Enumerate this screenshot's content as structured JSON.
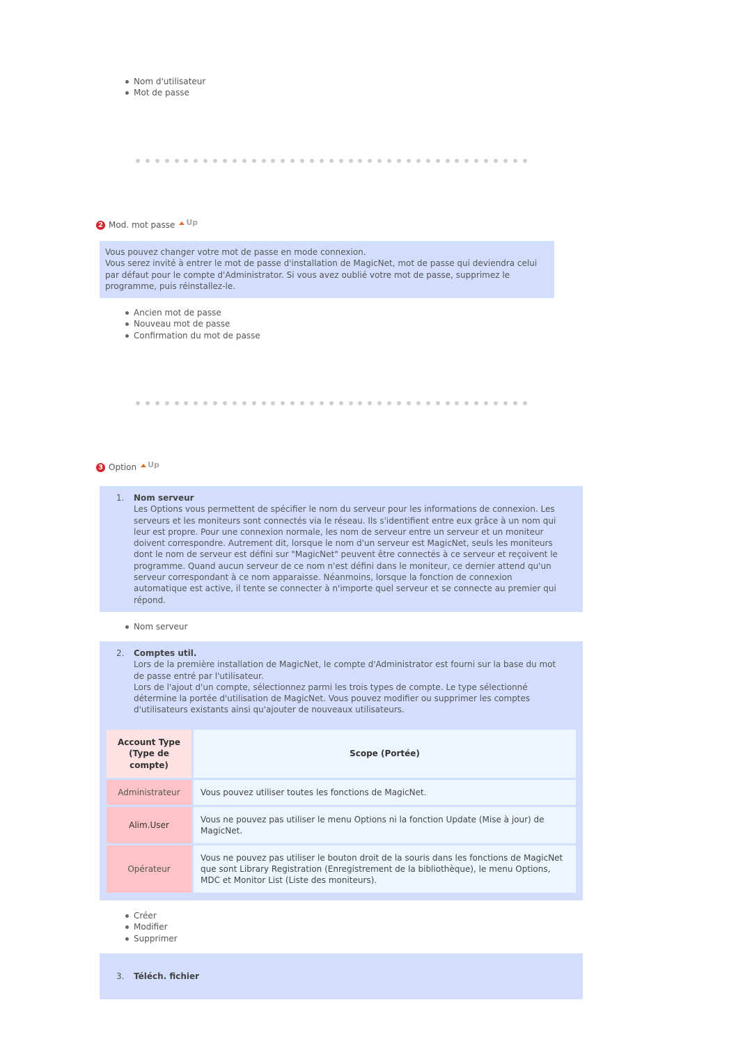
{
  "top_list": [
    "Nom d'utilisateur",
    "Mot de passe"
  ],
  "section2": {
    "number": "2",
    "title": "Mod. mot passe",
    "up_label": "Up",
    "info_lines": [
      "Vous pouvez changer votre mot de passe en mode connexion.",
      "Vous serez invité à entrer le mot de passe d'installation de MagicNet, mot de passe qui deviendra celui par défaut pour le compte d'Administrator. Si vous avez oublié votre mot de passe, supprimez le programme, puis réinstallez-le."
    ],
    "list": [
      "Ancien mot de passe",
      "Nouveau mot de passe",
      "Confirmation du mot de passe"
    ]
  },
  "section3": {
    "number": "3",
    "title": "Option",
    "up_label": "Up",
    "items": [
      {
        "num": "1.",
        "title": "Nom serveur",
        "body": "Les Options vous permettent de spécifier le nom du serveur pour les informations de connexion. Les serveurs et les moniteurs sont connectés via le réseau. Ils s'identifient entre eux grâce à un nom qui leur est propre. Pour une connexion normale, les nom de serveur entre un serveur et un moniteur doivent correspondre. Autrement dit, lorsque le nom d'un serveur est MagicNet, seuls les moniteurs dont le nom de serveur est défini sur \"MagicNet\" peuvent être connectés à ce serveur et reçoivent le programme. Quand aucun serveur de ce nom n'est défini dans le moniteur, ce dernier attend qu'un serveur correspondant à ce nom apparaisse. Néanmoins, lorsque la fonction de connexion automatique est active, il tente se connecter à n'importe quel serveur et se connecte au premier qui répond.",
        "list": [
          "Nom serveur"
        ]
      },
      {
        "num": "2.",
        "title": "Comptes util.",
        "body_lines": [
          "Lors de la première installation de MagicNet, le compte d'Administrator est fourni sur la base du mot de passe entré par l'utilisateur.",
          "Lors de l'ajout d'un compte, sélectionnez parmi les trois types de compte. Le type sélectionné détermine la portée d'utilisation de MagicNet. Vous pouvez modifier ou supprimer les comptes d'utilisateurs existants ainsi qu'ajouter de nouveaux utilisateurs."
        ],
        "table": {
          "headers": [
            "Account Type (Type de compte)",
            "Scope (Portée)"
          ],
          "rows": [
            [
              "Administrateur",
              "Vous pouvez utiliser toutes les fonctions de MagicNet."
            ],
            [
              "Alim.User",
              "Vous ne pouvez pas utiliser le menu Options ni la fonction Update (Mise à jour) de MagicNet."
            ],
            [
              "Opérateur",
              "Vous ne pouvez pas utiliser le bouton droit de la souris dans les fonctions de MagicNet que sont Library Registration (Enregistrement de la bibliothèque), le menu Options, MDC et Monitor List (Liste des moniteurs)."
            ]
          ]
        },
        "list": [
          "Créer",
          "Modifier",
          "Supprimer"
        ]
      },
      {
        "num": "3.",
        "title": "Téléch. fichier"
      }
    ]
  }
}
